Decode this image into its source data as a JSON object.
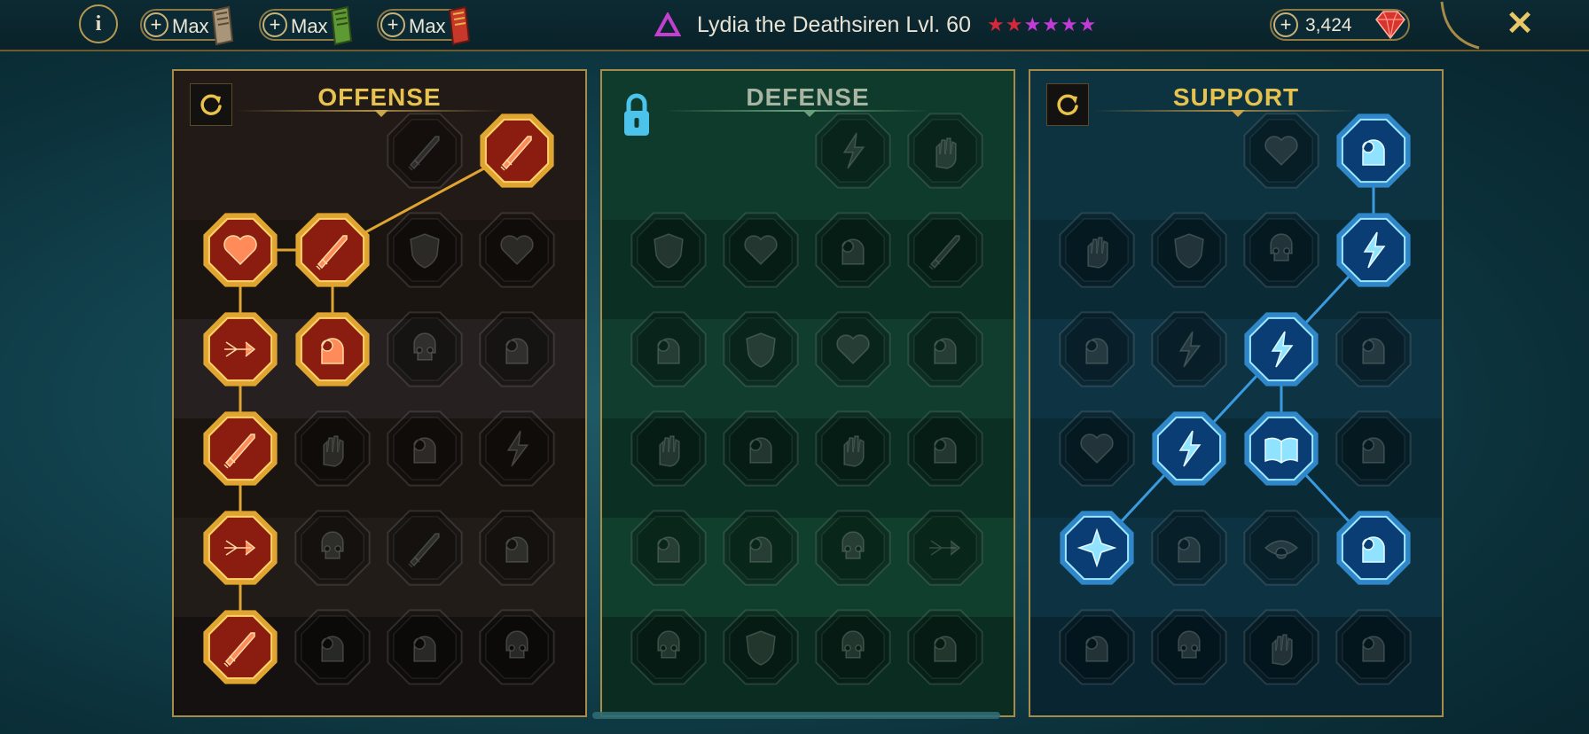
{
  "header": {
    "info_label": "i",
    "books": [
      {
        "label": "Max",
        "icon": "common-tome-icon",
        "color": "#b9a27a"
      },
      {
        "label": "Max",
        "icon": "uncommon-tome-icon",
        "color": "#6fae3c"
      },
      {
        "label": "Max",
        "icon": "rare-tome-icon",
        "color": "#d23a2a"
      }
    ],
    "champion": {
      "name": "Lydia the Deathsiren Lvl. 60",
      "affinity_icon": "magic-affinity-icon",
      "affinity_color": "#c23fd0",
      "stars": [
        {
          "color": "#d6283a"
        },
        {
          "color": "#d6283a"
        },
        {
          "color": "#c33ad6"
        },
        {
          "color": "#c33ad6"
        },
        {
          "color": "#c33ad6"
        },
        {
          "color": "#c33ad6"
        }
      ]
    },
    "gems": {
      "value": "3,424",
      "icon": "ruby-gem-icon"
    },
    "close_label": "✕"
  },
  "trees": [
    {
      "key": "offense",
      "title": "OFFENSE",
      "title_color": "#e6c34f",
      "control": "reset",
      "accent": "#e0a531",
      "link_color": "#e0a531",
      "icon_color": "#ff8a5a",
      "bands": [
        "#221a16",
        "#1b1512",
        "#262020",
        "#1b1512",
        "#221c19",
        "#151110"
      ],
      "rows": [
        [
          null,
          null,
          "crossed-swords-icon",
          "dagger-burst-icon"
        ],
        [
          "demon-heart-icon",
          "sword-slash-icon",
          "shield-arrow-icon",
          "bleeding-heart-icon"
        ],
        [
          "arrows-impaled-icon",
          "fanged-maw-icon",
          "skull-cloak-icon",
          "claw-slash-icon"
        ],
        [
          "dripping-sword-icon",
          "iron-fist-icon",
          "axe-icon",
          "chain-lightning-icon"
        ],
        [
          "arrows-target-icon",
          "skulls-icon",
          "sword-aura-icon",
          "warrior-rage-icon"
        ],
        [
          "sword-stars-icon",
          "knight-helm-icon",
          "horned-demon-icon",
          "spartan-skull-icon"
        ]
      ],
      "unlocked": [
        [
          0,
          3
        ],
        [
          1,
          0
        ],
        [
          1,
          1
        ],
        [
          2,
          0
        ],
        [
          2,
          1
        ],
        [
          3,
          0
        ],
        [
          4,
          0
        ],
        [
          5,
          0
        ]
      ],
      "links": [
        [
          [
            0,
            3
          ],
          [
            1,
            1
          ]
        ],
        [
          [
            1,
            0
          ],
          [
            1,
            1
          ]
        ],
        [
          [
            1,
            0
          ],
          [
            2,
            0
          ]
        ],
        [
          [
            1,
            1
          ],
          [
            2,
            1
          ]
        ],
        [
          [
            2,
            0
          ],
          [
            3,
            0
          ]
        ],
        [
          [
            3,
            0
          ],
          [
            4,
            0
          ]
        ],
        [
          [
            4,
            0
          ],
          [
            5,
            0
          ]
        ]
      ]
    },
    {
      "key": "defense",
      "title": "DEFENSE",
      "title_color": "#a9b5a3",
      "control": "locked",
      "accent": "#6fa37f",
      "link_color": "#6fa37f",
      "icon_color": "#7fb3ff",
      "bands": [
        "#0f3b2c",
        "#0b3023",
        "#103d2d",
        "#0b3023",
        "#113f2e",
        "#0a2c21"
      ],
      "rows": [
        [
          null,
          null,
          "cracked-armor-icon",
          "raised-fist-icon"
        ],
        [
          "draped-shield-icon",
          "heart-shield-icon",
          "warrior-stance-icon",
          "broken-sword-icon"
        ],
        [
          "muscle-arm-icon",
          "knight-shield-icon",
          "heart-skull-icon",
          "monk-aura-icon"
        ],
        [
          "reaching-hands-icon",
          "hourglass-icon",
          "open-palm-icon",
          "bull-head-icon"
        ],
        [
          "running-man-icon",
          "water-drops-icon",
          "sun-skull-icon",
          "cycle-arrow-icon"
        ],
        [
          "flaming-skull-icon",
          "winged-shield-icon",
          "bearded-skull-icon",
          "strongman-icon"
        ]
      ],
      "unlocked": [],
      "links": []
    },
    {
      "key": "support",
      "title": "SUPPORT",
      "title_color": "#e6c34f",
      "control": "reset",
      "accent": "#2f86c8",
      "link_color": "#3a9be0",
      "icon_color": "#8fe3ff",
      "bands": [
        "#0d3240",
        "#0a2a36",
        "#0e3444",
        "#0a2a36",
        "#0d3343",
        "#092531"
      ],
      "rows": [
        [
          null,
          null,
          "healing-heart-icon",
          "slash-spiral-icon"
        ],
        [
          "praying-hands-icon",
          "layered-shield-icon",
          "smoke-skull-icon",
          "energy-strike-icon"
        ],
        [
          "sparkle-figure-icon",
          "lightning-circle-icon",
          "ground-crack-icon",
          "glowing-body-icon"
        ],
        [
          "chained-heart-icon",
          "comet-icon",
          "open-book-icon",
          "lion-face-icon"
        ],
        [
          "compass-star-icon",
          "speed-boot-icon",
          "eye-icon",
          "pierced-figure-icon"
        ],
        [
          "poison-flask-icon",
          "grim-skull-icon",
          "fist-helm-icon",
          "eagle-head-icon"
        ]
      ],
      "unlocked": [
        [
          0,
          3
        ],
        [
          1,
          3
        ],
        [
          2,
          2
        ],
        [
          3,
          1
        ],
        [
          3,
          2
        ],
        [
          4,
          0
        ],
        [
          4,
          3
        ]
      ],
      "links": [
        [
          [
            0,
            3
          ],
          [
            1,
            3
          ]
        ],
        [
          [
            1,
            3
          ],
          [
            2,
            2
          ]
        ],
        [
          [
            2,
            2
          ],
          [
            3,
            1
          ]
        ],
        [
          [
            2,
            2
          ],
          [
            3,
            2
          ]
        ],
        [
          [
            3,
            1
          ],
          [
            4,
            0
          ]
        ],
        [
          [
            3,
            2
          ],
          [
            4,
            3
          ]
        ]
      ]
    }
  ]
}
